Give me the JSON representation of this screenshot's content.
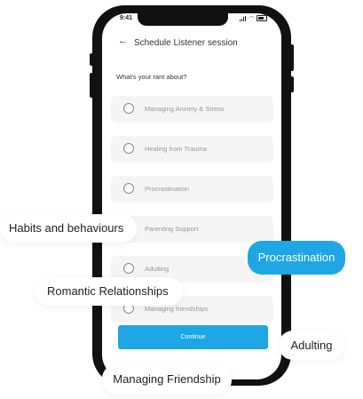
{
  "status": {
    "time": "9:41"
  },
  "header": {
    "title": "Schedule Listener session"
  },
  "question": "What's your rant about?",
  "options": [
    {
      "label": "Managing Anxiety & Stress"
    },
    {
      "label": "Healing from Trauma"
    },
    {
      "label": "Procrastination"
    },
    {
      "label": "Parenting Support"
    },
    {
      "label": "Adulting"
    },
    {
      "label": "Managing friendships"
    }
  ],
  "continue_label": "Continue",
  "tags": {
    "habits": "Habits and behaviours",
    "procrastination": "Procrastination",
    "romantic": "Romantic Relationships",
    "adulting": "Adulting",
    "friendship": "Managing Friendship"
  },
  "colors": {
    "accent": "#1ea7e4",
    "frame": "#111111"
  }
}
